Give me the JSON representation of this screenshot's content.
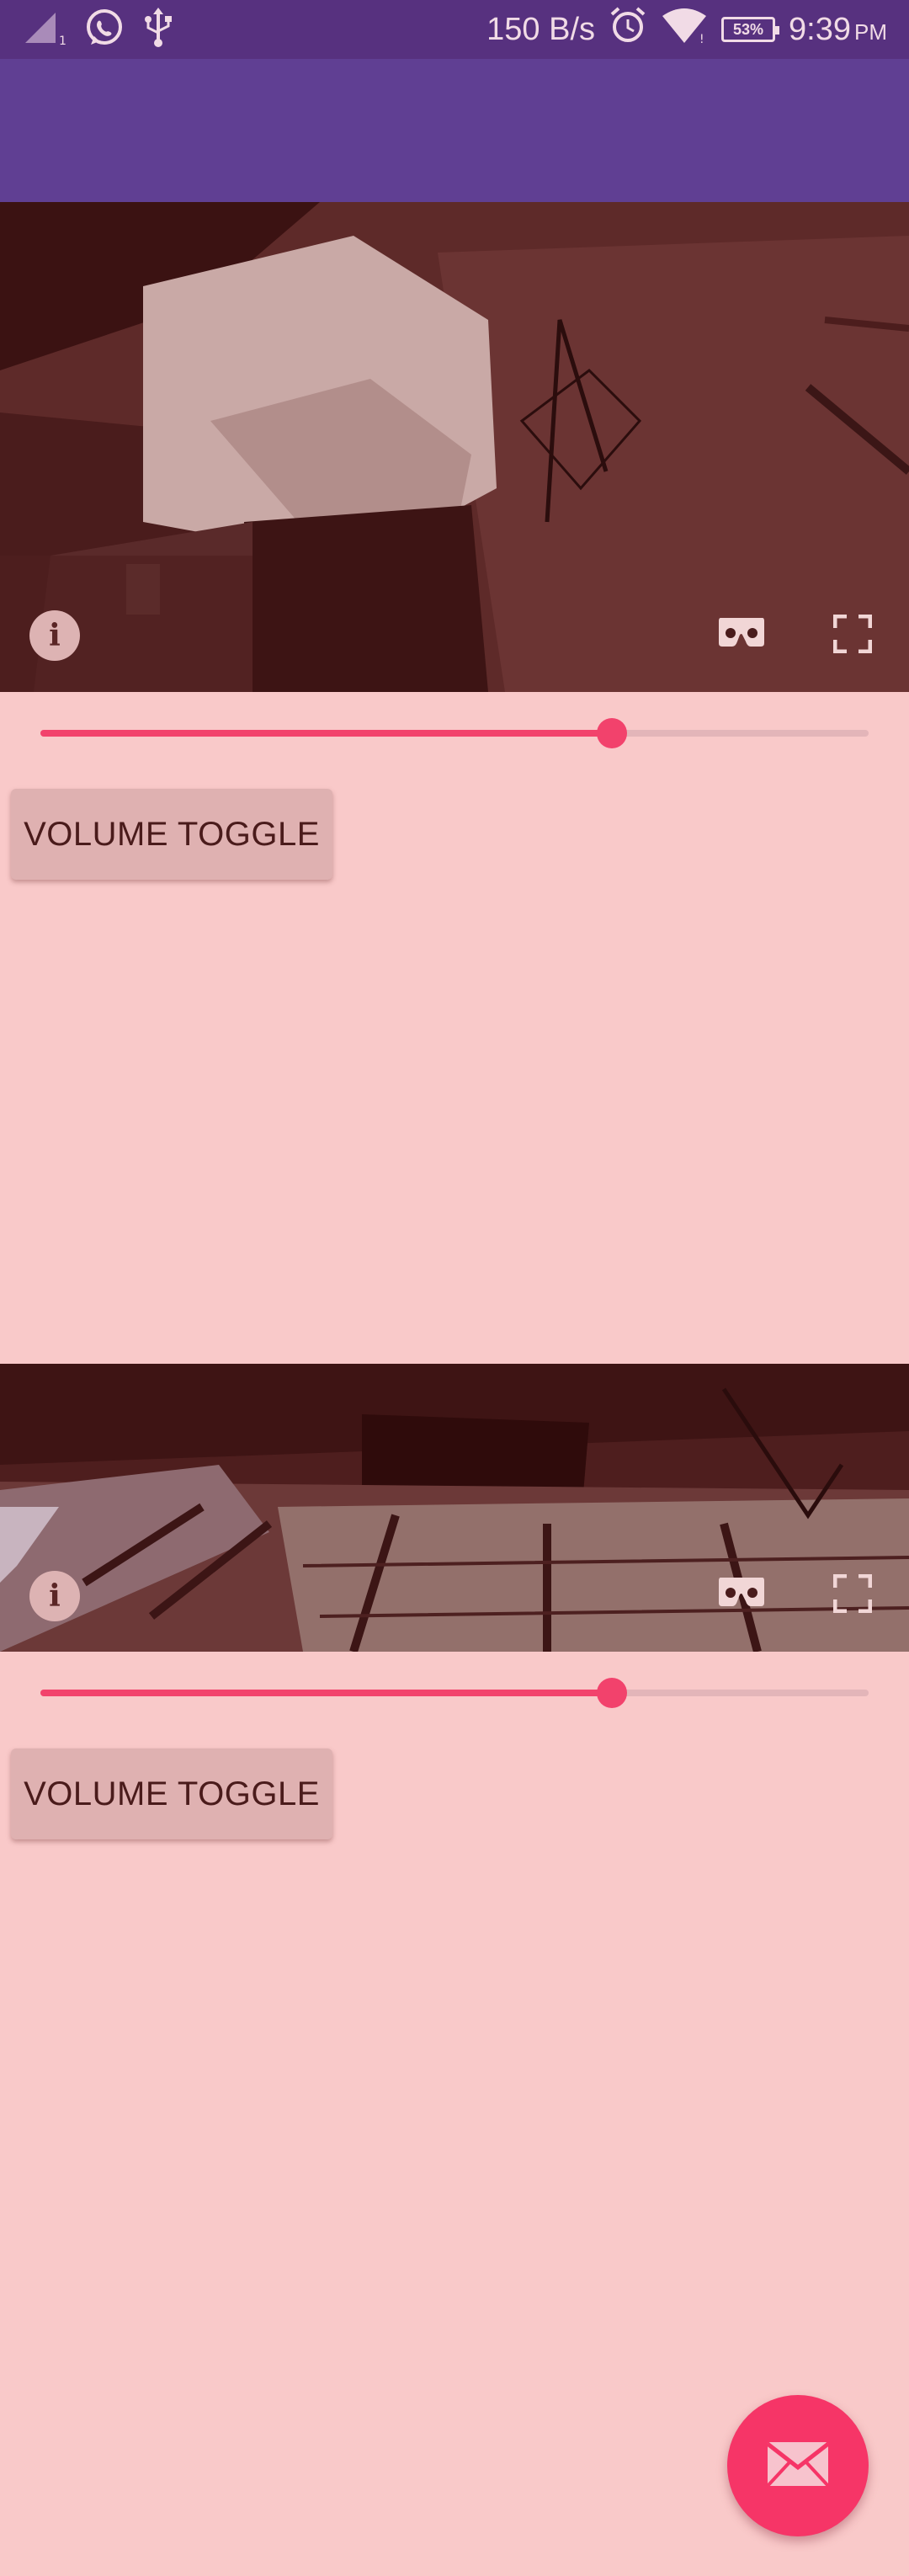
{
  "status_bar": {
    "network_speed": "150 B/s",
    "battery_percent": "53%",
    "time": "9:39",
    "time_suffix": "PM",
    "icons": [
      "signal-icon",
      "whatsapp-icon",
      "usb-icon",
      "alarm-icon",
      "wifi-icon",
      "battery-icon"
    ]
  },
  "players": [
    {
      "volume_level": 0.69,
      "button_label": "VOLUME TOGGLE",
      "controls": [
        "info-icon",
        "cardboard-vr-icon",
        "fullscreen-icon"
      ]
    },
    {
      "volume_level": 0.69,
      "button_label": "VOLUME TOGGLE",
      "controls": [
        "info-icon",
        "cardboard-vr-icon",
        "fullscreen-icon"
      ]
    }
  ],
  "fab": {
    "icon": "email-icon"
  },
  "colors": {
    "status_bar": "#57317f",
    "app_bar": "#603f93",
    "background": "#f9c9c9",
    "accent": "#f2426c",
    "fab": "#f63567"
  }
}
